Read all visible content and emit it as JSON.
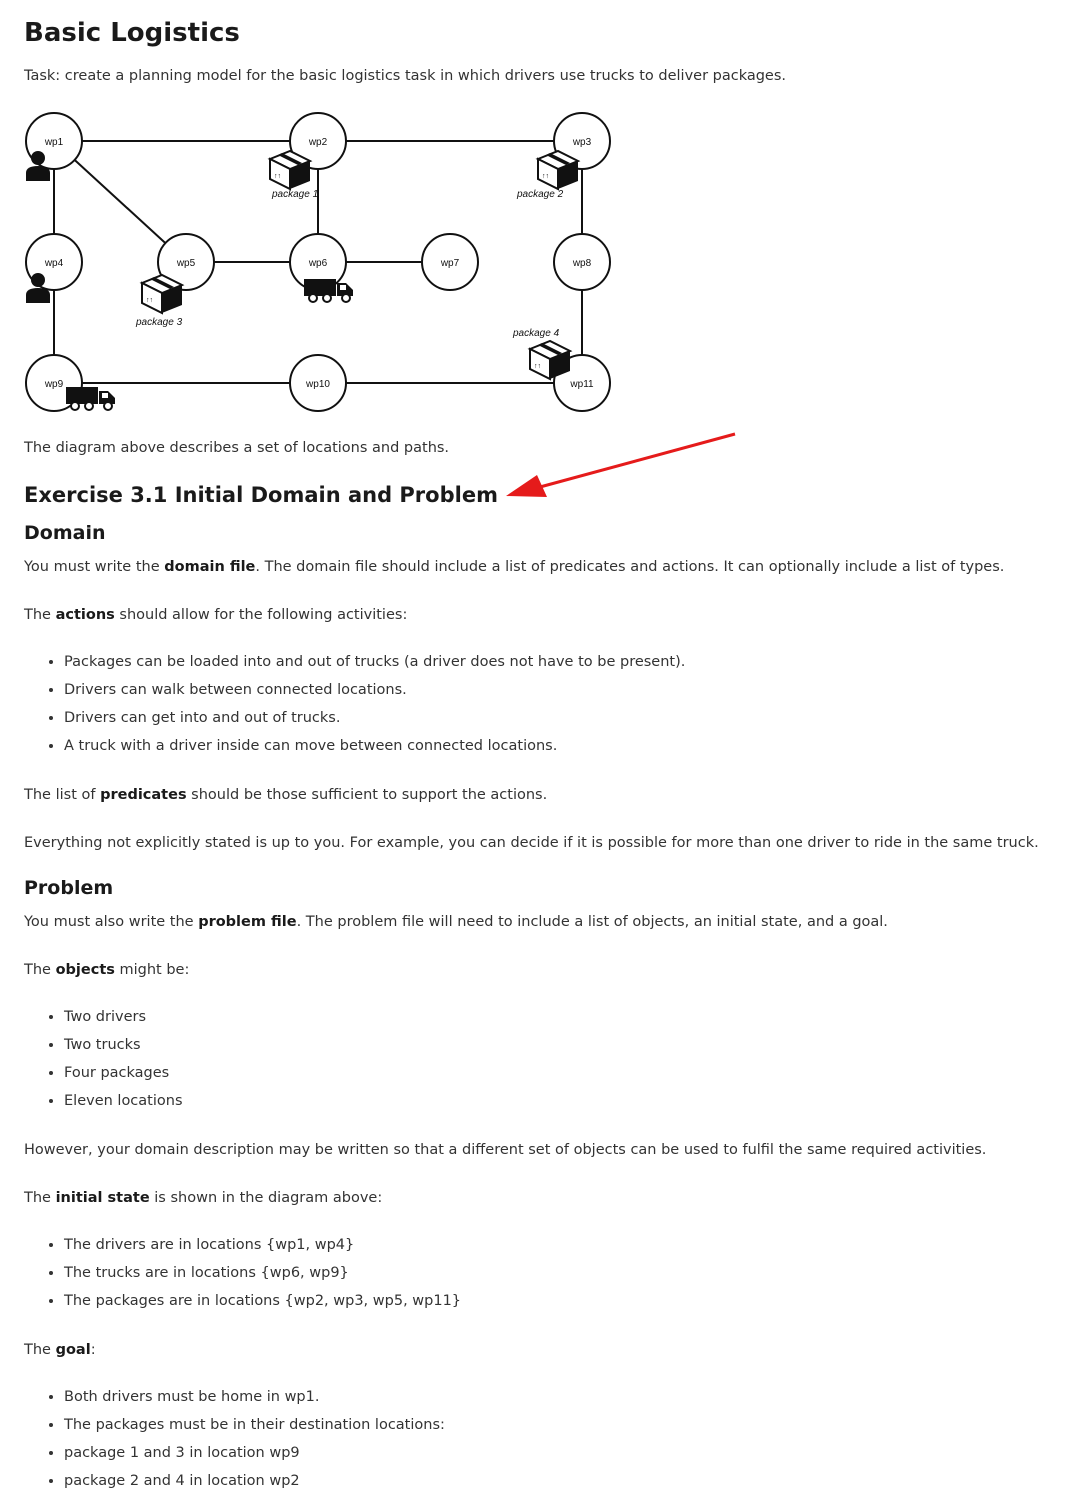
{
  "title": "Basic Logistics",
  "task": "Task: create a planning model for the basic logistics task in which drivers use trucks to deliver packages.",
  "diagram": {
    "nodes": [
      "wp1",
      "wp2",
      "wp3",
      "wp4",
      "wp5",
      "wp6",
      "wp7",
      "wp8",
      "wp9",
      "wp10",
      "wp11"
    ],
    "package_labels": [
      "package 1",
      "package 2",
      "package 3",
      "package 4"
    ]
  },
  "diagram_caption": "The diagram above describes a set of locations and paths.",
  "exercise_heading": "Exercise 3.1 Initial Domain and Problem",
  "domain": {
    "heading": "Domain",
    "intro": {
      "pre": "You must write the ",
      "bold": "domain file",
      "post": ". The domain file should include a list of predicates and actions. It can optionally include a list of types."
    },
    "actions_intro": {
      "pre": "The ",
      "bold": "actions",
      "post": " should allow for the following activities:"
    },
    "actions": [
      "Packages can be loaded into and out of trucks (a driver does not have to be present).",
      "Drivers can walk between connected locations.",
      "Drivers can get into and out of trucks.",
      "A truck with a driver inside can move between connected locations."
    ],
    "predicates": {
      "pre": "The list of ",
      "bold": "predicates",
      "post": " should be those sufficient to support the actions."
    },
    "note": "Everything not explicitly stated is up to you. For example, you can decide if it is possible for more than one driver to ride in the same truck."
  },
  "problem": {
    "heading": "Problem",
    "intro": {
      "pre": "You must also write the ",
      "bold": "problem file",
      "post": ". The problem file will need to include a list of objects, an initial state, and a goal."
    },
    "objects_intro": {
      "pre": "The ",
      "bold": "objects",
      "post": " might be:"
    },
    "objects": [
      "Two drivers",
      "Two trucks",
      "Four packages",
      "Eleven locations"
    ],
    "however": "However, your domain description may be written so that a different set of objects can be used to fulfil the same required activities.",
    "initial_intro": {
      "pre": "The ",
      "bold": "initial state",
      "post": " is shown in the diagram above:"
    },
    "initial": [
      "The drivers are in locations {wp1, wp4}",
      "The trucks are in locations {wp6, wp9}",
      "The packages are in locations {wp2, wp3, wp5, wp11}"
    ],
    "goal_intro": {
      "pre": "The ",
      "bold": "goal",
      "post": ":"
    },
    "goal": [
      "Both drivers must be home in wp1.",
      "The packages must be in their destination locations:",
      "package 1 and 3 in location wp9",
      "package 2 and 4 in location wp2"
    ]
  }
}
